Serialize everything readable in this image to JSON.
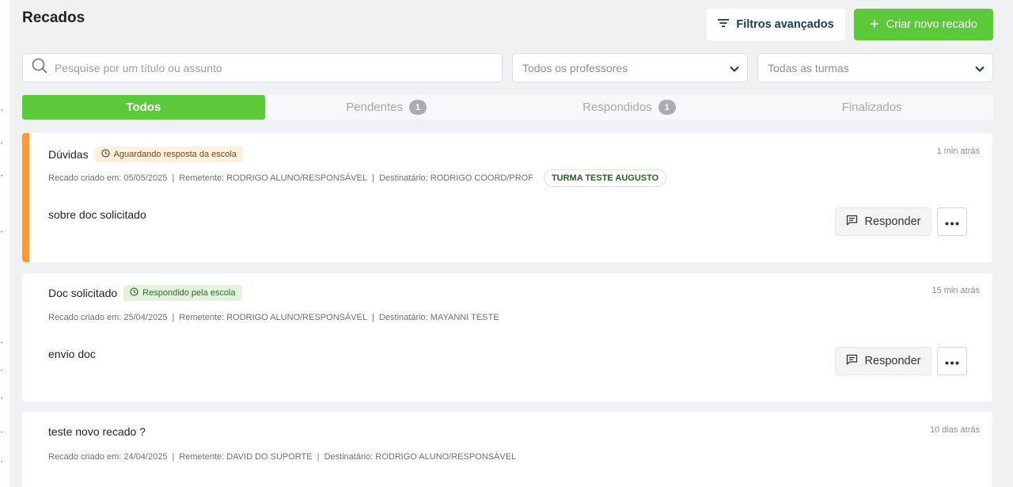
{
  "page": {
    "title": "Recados"
  },
  "toolbar": {
    "filters_label": "Filtros avançados",
    "create_label": "Criar novo recado"
  },
  "search": {
    "placeholder": "Pesquise por um título ou assunto",
    "value": ""
  },
  "filters": {
    "teachers": "Todos os professores",
    "classes": "Todas as turmas"
  },
  "tabs": [
    {
      "label": "Todos",
      "count": null,
      "active": true
    },
    {
      "label": "Pendentes",
      "count": "1",
      "active": false
    },
    {
      "label": "Respondidos",
      "count": "1",
      "active": false
    },
    {
      "label": "Finalizados",
      "count": null,
      "active": false
    }
  ],
  "messages": [
    {
      "title": "Dúvidas",
      "status": "Aguardando resposta da escola",
      "time": "1 min atrás",
      "created": "Recado criado em: 05/05/2025",
      "sender": "Remetente: RODRIGO ALUNO/RESPONSÁVEL",
      "recipient": "Destinatário: RODRIGO COORD/PROF",
      "class_badge": "TURMA TESTE AUGUSTO",
      "body": "sobre doc solicitado",
      "reply_label": "Responder"
    },
    {
      "title": "Doc solicitado",
      "status": "Respondido pela escola",
      "time": "15 min atrás",
      "created": "Recado criado em: 25/04/2025",
      "sender": "Remetente: RODRIGO ALUNO/RESPONSÁVEL",
      "recipient": "Destinatário: MAYANNI TESTE",
      "body": "envio doc",
      "reply_label": "Responder"
    },
    {
      "title": "teste novo recado ?",
      "time": "10 dias atrás",
      "created": "Recado criado em: 24/04/2025",
      "sender": "Remetente: DAVID DO SUPORTE",
      "recipient": "Destinatário: RODRIGO ALUNO/RESPONSÁVEL"
    }
  ],
  "colors": {
    "accent": "#5bc93a",
    "pending_bar": "#f59b3b",
    "dark_blue": "#143a55"
  },
  "icons": [
    "filter-icon",
    "plus-icon",
    "search-icon",
    "chevron-down-icon",
    "clock-icon",
    "chat-icon",
    "more-icon"
  ]
}
